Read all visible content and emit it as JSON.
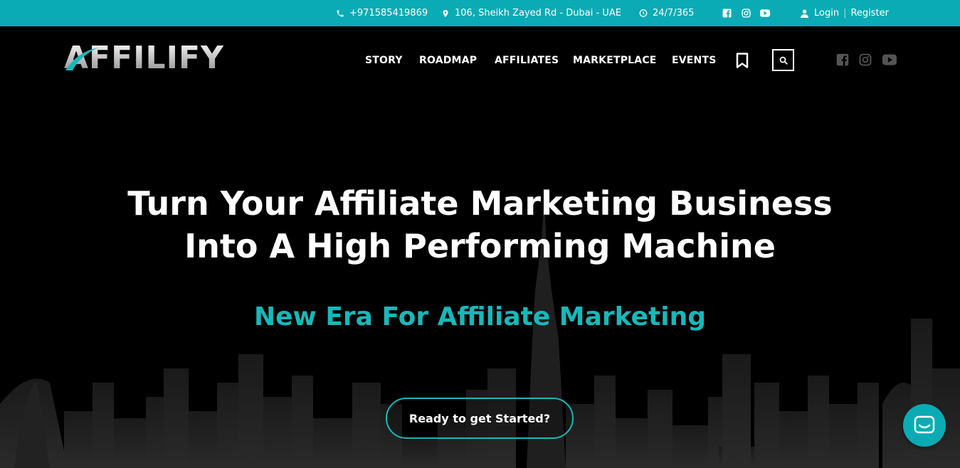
{
  "topbar": {
    "phone": "+971585419869",
    "address": "106, Sheikh Zayed Rd - Dubai - UAE",
    "hours": "24/7/365",
    "login": "Login",
    "register": "Register",
    "separator": "|"
  },
  "header": {
    "logo_text": "AFFILIFY",
    "nav": [
      "STORY",
      "ROADMAP",
      "AFFILIATES",
      "MARKETPLACE",
      "EVENTS"
    ]
  },
  "hero": {
    "title_line1": "Turn Your Affiliate Marketing Business",
    "title_line2": "Into A High Performing Machine",
    "subtitle": "New Era For Affiliate Marketing",
    "cta": "Ready to get Started?"
  },
  "colors": {
    "accent": "#0aabb4",
    "accent_text": "#1ab7b9",
    "background": "#000000"
  },
  "icons": [
    "phone-icon",
    "location-icon",
    "clock-icon",
    "facebook-icon",
    "instagram-icon",
    "youtube-icon",
    "user-icon",
    "bookmark-icon",
    "search-icon",
    "chat-icon"
  ]
}
